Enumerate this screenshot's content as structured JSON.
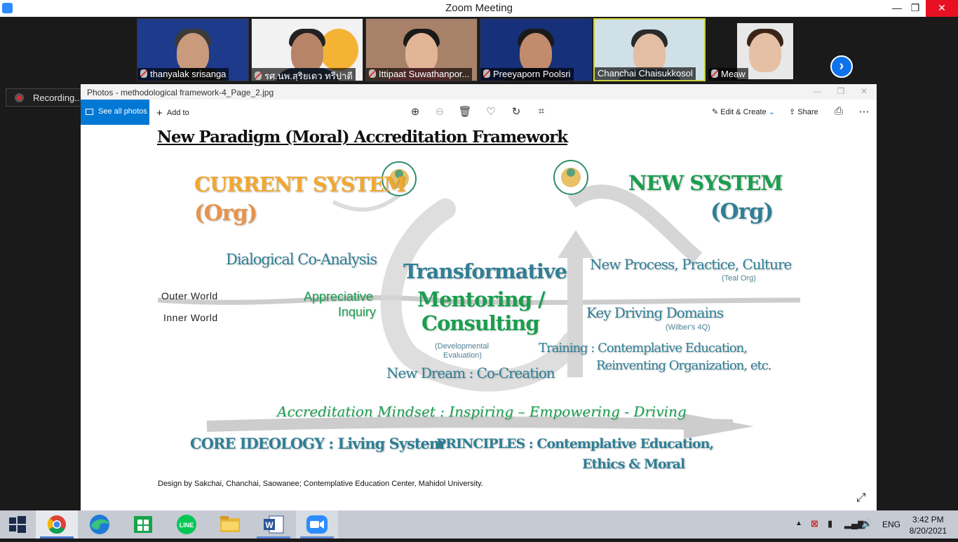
{
  "zoom": {
    "title": "Zoom Meeting",
    "participants": [
      {
        "name": "thanyalak srisanga",
        "muted": true
      },
      {
        "name": "รศ.นพ.สุริยเดว ทรีปาตี",
        "muted": true
      },
      {
        "name": "Ittipaat Suwathanpor...",
        "muted": true
      },
      {
        "name": "Preeyaporn Poolsri",
        "muted": true
      },
      {
        "name": "Chanchai Chaisukkosol",
        "muted": false,
        "active": true
      },
      {
        "name": "Meaw",
        "muted": true
      }
    ],
    "recording_label": "Recording...",
    "window_buttons": {
      "minimize": "—",
      "restore": "❐",
      "close": "✕"
    }
  },
  "photos": {
    "window_title": "Photos - methodological framework-4_Page_2.jpg",
    "toolbar": {
      "see_all": "See all photos",
      "add_to": "Add to",
      "edit_create": "Edit & Create",
      "share": "Share"
    }
  },
  "slide": {
    "title": "New Paradigm (Moral) Accreditation Framework",
    "current_system": "CURRENT SYSTEM",
    "current_org": "(Org)",
    "new_system": "NEW SYSTEM",
    "new_org": "(Org)",
    "dialogical": "Dialogical Co-Analysis",
    "outer_world": "Outer World",
    "inner_world": "Inner World",
    "appreciative": "Appreciative",
    "inquiry": "Inquiry",
    "transformative": "Transformative",
    "mentoring": "Mentoring /",
    "consulting": "Consulting",
    "developmental": "(Developmental",
    "evaluation": "Evaluation)",
    "new_dream": "New Dream :  Co-Creation",
    "new_process": "New Process, Practice, Culture",
    "teal_org": "(Teal Org)",
    "key_driving": "Key Driving Domains",
    "wilber": "(Wilber's 4Q)",
    "training": "Training  : Contemplative Education,",
    "reinventing": "Reinventing Organization, etc.",
    "mindset": "Accreditation Mindset : Inspiring – Empowering - Driving",
    "core": "CORE IDEOLOGY : Living System",
    "principles": "PRINCIPLES : Contemplative Education,",
    "ethics": "Ethics & Moral",
    "credit": "Design by Sakchai, Chanchai, Saowanee; Contemplative Education Center, Mahidol University."
  },
  "taskbar": {
    "lang": "ENG",
    "time": "3:42 PM",
    "date": "8/20/2021"
  },
  "colors": {
    "orange": "#f0a830",
    "teal": "#2f7f95",
    "green": "#1a9e4f",
    "zoom_blue": "#0e72ed"
  }
}
